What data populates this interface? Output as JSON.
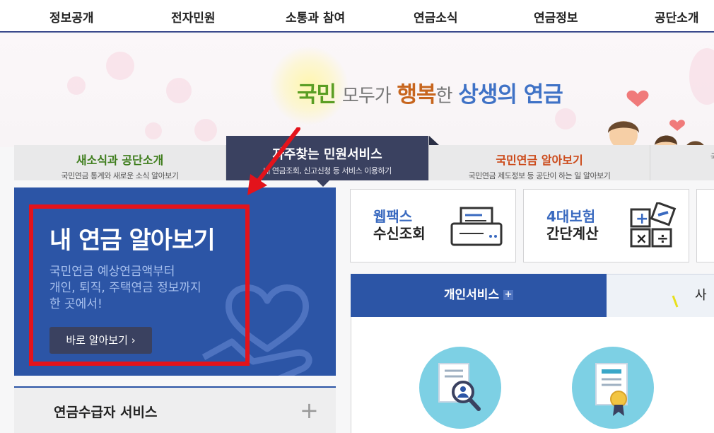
{
  "nav": [
    "정보공개",
    "전자민원",
    "소통과 참여",
    "연금소식",
    "연금정보",
    "공단소개"
  ],
  "slogan": {
    "part1": "국민",
    "part2": "모두가",
    "part3": "행복",
    "part4": "한",
    "part5": "상생의 연금"
  },
  "tabs": [
    {
      "title": "새소식과 공단소개",
      "desc": "국민연금 통계와 새로운 소식 알아보기"
    },
    {
      "title": "자주찾는 민원서비스",
      "desc": "내 연금조회, 신고신청 등 서비스 이용하기"
    },
    {
      "title": "국민연금 알아보기",
      "desc": "국민연금 제도정보 등 공단이 하는 일 알아보기"
    },
    {
      "title": "",
      "desc": "국"
    }
  ],
  "promo": {
    "title": "내 연금 알아보기",
    "desc_line1": "국민연금 예상연금액부터",
    "desc_line2": "개인, 퇴직, 주택연금 정보까지",
    "desc_line3": "한 곳에서!",
    "button": "바로 알아보기 ›"
  },
  "cards": [
    {
      "line1": "웹팩스",
      "line2": "수신조회",
      "icon": "fax-icon"
    },
    {
      "line1": "4대보험",
      "line2": "간단계산",
      "icon": "calculator-icon"
    }
  ],
  "services": {
    "tab_on": "개인서비스",
    "tab_on_plus": "+",
    "tab_off": "사업"
  },
  "accordion": {
    "label": "연금수급자 서비스",
    "plus": "+"
  },
  "colors": {
    "primary": "#2c55a6",
    "dark": "#3a4160",
    "highlight": "#e3131b"
  }
}
